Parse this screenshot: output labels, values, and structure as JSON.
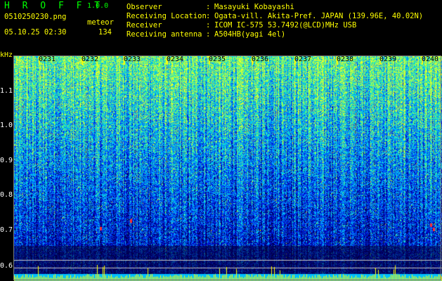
{
  "app": {
    "title": "H R O F F T",
    "version": "1.0.0"
  },
  "file": {
    "name": "0510250230.png",
    "datetime": "05.10.25 02:30"
  },
  "counter": {
    "label": "meteor",
    "value": "134"
  },
  "station": {
    "observer_label": "Observer",
    "observer": "Masayuki Kobayashi",
    "location_label": "Receiving Location",
    "location": "Ogata-vill. Akita-Pref. JAPAN (139.96E, 40.02N)",
    "receiver_label": "Receiver",
    "receiver": "ICOM IC-575 53.7492(@LCD)MHz USB",
    "antenna_label": "Receiving antenna",
    "antenna": "A504HB(yagi 4el)"
  },
  "colors": {
    "label": "#ffff00",
    "title": "#00ff00",
    "axis": "#ffffff",
    "trace": "#ffff00",
    "baseline": "#00c0ff"
  },
  "chart_data": {
    "type": "heatmap",
    "ylabel": "kHz",
    "y_ticks": [
      "1.1",
      "1.0",
      "0.9",
      "0.8",
      "0.7",
      "0.6"
    ],
    "x_ticks": [
      "0231",
      "0232",
      "0233",
      "0234",
      "0235",
      "0236",
      "0237",
      "0238",
      "0239",
      "0240"
    ]
  }
}
